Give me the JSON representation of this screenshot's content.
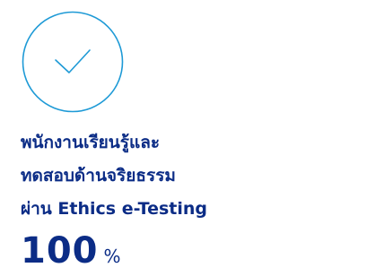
{
  "icon": {
    "name": "check-circle-icon",
    "color": "#1E9AD6"
  },
  "headline": {
    "line1": "พนักงานเรียนรู้และ",
    "line2": "ทดสอบด้านจริยธรรม",
    "line3": "ผ่าน Ethics e-Testing",
    "color": "#0B2C86"
  },
  "stat": {
    "value": "100",
    "unit": "%"
  }
}
